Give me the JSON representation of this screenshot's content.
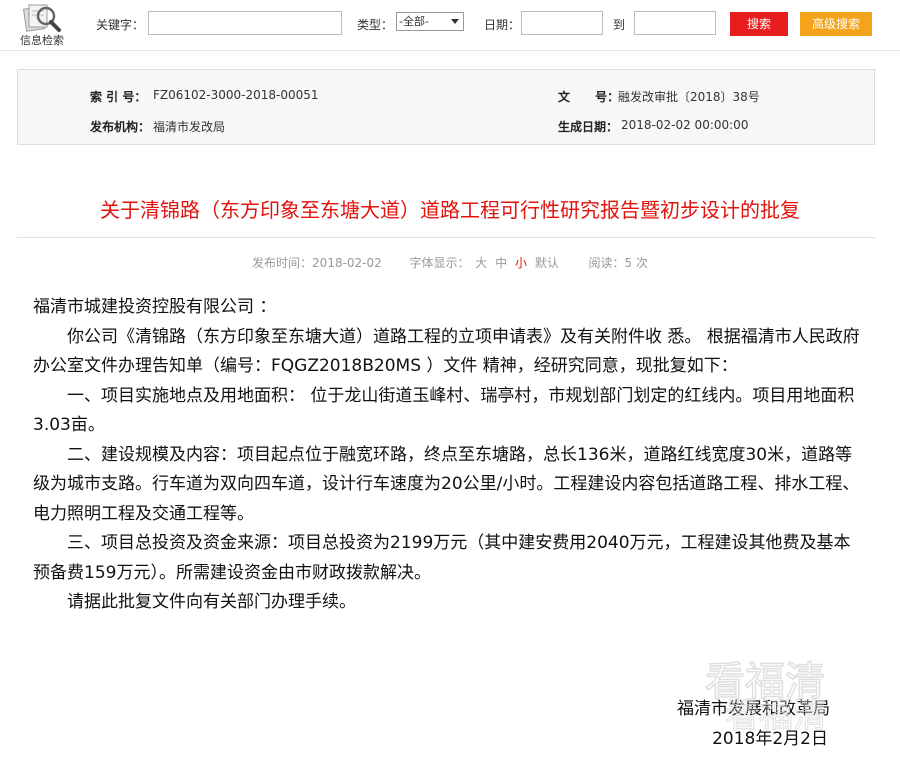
{
  "search": {
    "logo_label": "信息检索",
    "keyword_label": "关键字：",
    "keyword_value": "",
    "type_label": "类型：",
    "type_selected": "-全部-",
    "date_label": "日期：",
    "date_from": "",
    "to_label": "到",
    "date_to": "",
    "search_button": "搜索",
    "advanced_button": "高级搜索"
  },
  "meta": {
    "index_label": "索 引 号：",
    "index_value": "FZ06102-3000-2018-00051",
    "docno_label": "文      号：",
    "docno_value": "融发改审批〔2018〕38号",
    "publisher_label": "发布机构：",
    "publisher_value": "福清市发改局",
    "date_label": "生成日期：",
    "date_value": "2018-02-02 00:00:00"
  },
  "article": {
    "title": "关于清锦路（东方印象至东塘大道）道路工程可行性研究报告暨初步设计的批复",
    "publish_time": "发布时间：2018-02-02",
    "font_label": "字体显示：",
    "font_large": "大",
    "font_medium": "中",
    "font_small": "小",
    "font_default": "默认",
    "reads": "阅读：5 次",
    "paragraphs": [
      "福清市城建投资控股有限公司 ：",
      "你公司《清锦路（东方印象至东塘大道）道路工程的立项申请表》及有关附件收 悉。 根据福清市人民政府办公室文件办理告知单（编号：FQGZ2018B20MS ）文件 精神，经研究同意，现批复如下：",
      "一、项目实施地点及用地面积： 位于龙山街道玉峰村、瑞亭村，市规划部门划定的红线内。项目用地面积3.03亩。",
      "二、建设规模及内容：项目起点位于融宽环路，终点至东塘路，总长136米，道路红线宽度30米，道路等级为城市支路。行车道为双向四车道，设计行车速度为20公里/小时。工程建设内容包括道路工程、排水工程、电力照明工程及交通工程等。",
      "三、项目总投资及资金来源：项目总投资为2199万元（其中建安费用2040万元，工程建设其他费及基本预备费159万元）。所需建设资金由市财政拨款解决。",
      "请据此批复文件向有关部门办理手续。"
    ],
    "signature": "福清市发展和改革局",
    "sign_date": "2018年2月2日"
  },
  "watermark": {
    "text": "看福清"
  },
  "colors": {
    "title_red": "#e2130d",
    "search_red": "#e81d1d",
    "advanced_orange": "#f5a31a"
  }
}
